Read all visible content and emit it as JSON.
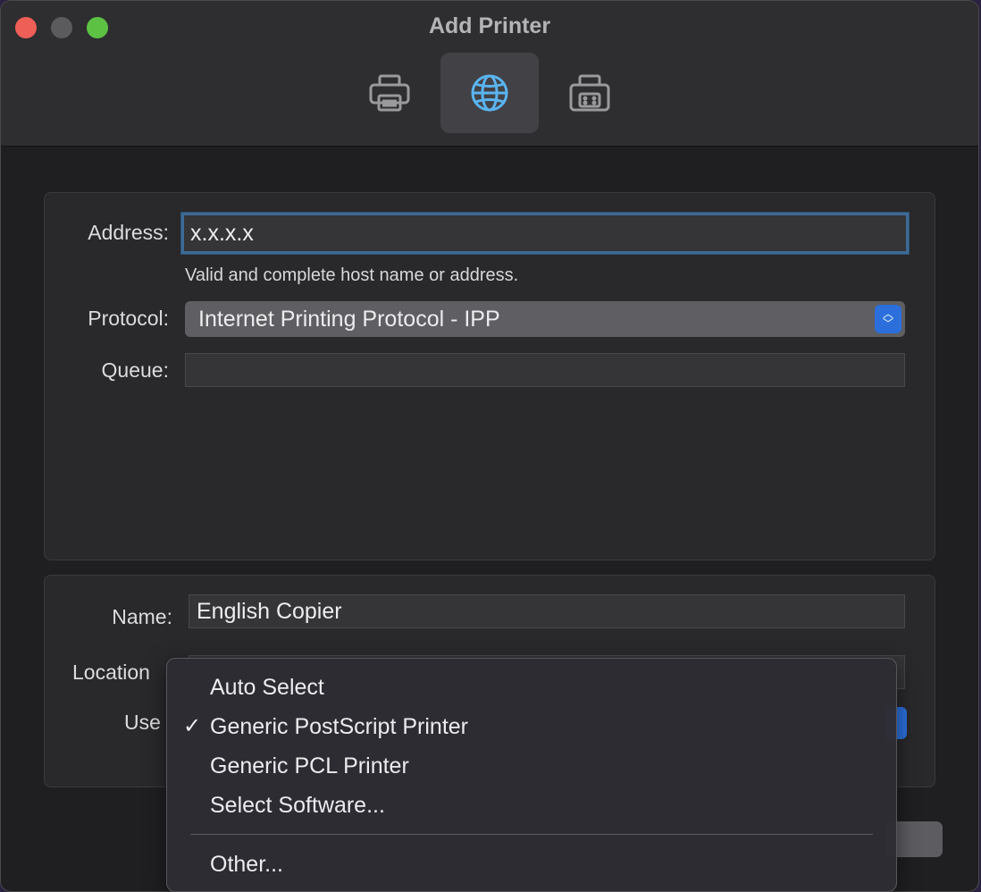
{
  "window": {
    "title": "Add Printer"
  },
  "toolbar": {
    "items": [
      {
        "icon": "printer-icon",
        "active": false
      },
      {
        "icon": "globe-icon",
        "active": true
      },
      {
        "icon": "fax-printer-icon",
        "active": false
      }
    ]
  },
  "form": {
    "address_label": "Address:",
    "address_value": "x.x.x.x",
    "address_hint": "Valid and complete host name or address.",
    "protocol_label": "Protocol:",
    "protocol_value": "Internet Printing Protocol - IPP",
    "queue_label": "Queue:",
    "queue_value": "",
    "name_label": "Name:",
    "name_value": "English Copier",
    "location_label": "Location",
    "use_label": "Use"
  },
  "use_menu": {
    "items": [
      {
        "label": "Auto Select",
        "checked": false
      },
      {
        "label": "Generic PostScript Printer",
        "checked": true
      },
      {
        "label": "Generic PCL Printer",
        "checked": false
      },
      {
        "label": "Select Software...",
        "checked": false
      }
    ],
    "other_label": "Other...",
    "check_glyph": "✓"
  },
  "colors": {
    "accent": "#2b6fdc",
    "focus_ring": "#3d6b97",
    "globe_active": "#5ab4f0",
    "icon_inactive": "#9a999c"
  }
}
